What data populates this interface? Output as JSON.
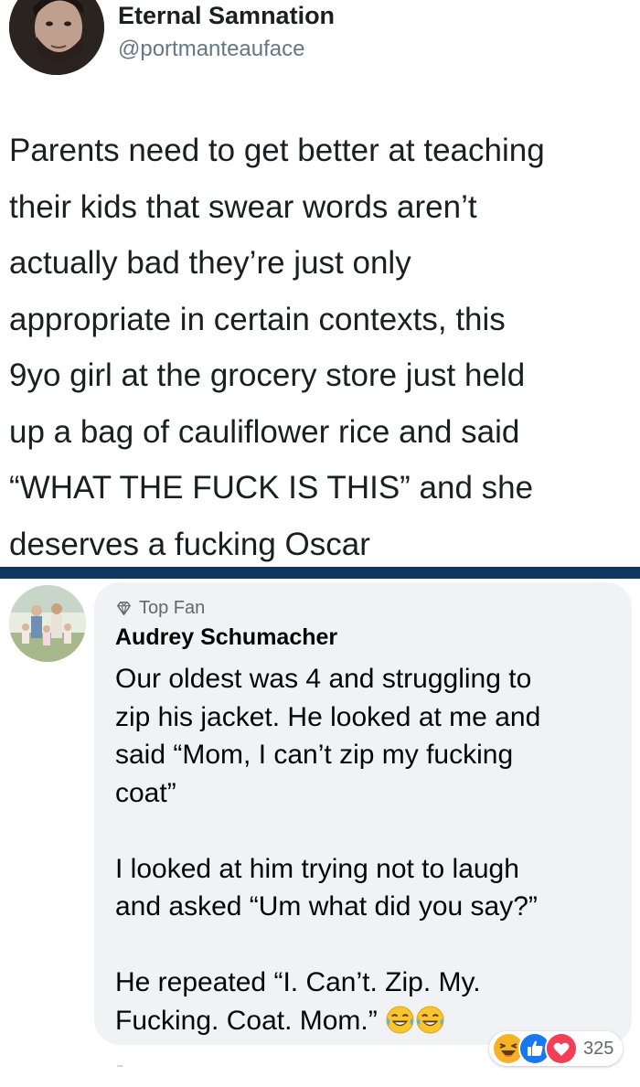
{
  "tweet": {
    "author_name": "Eternal Samnation",
    "handle": "@portmanteauface",
    "lines": [
      "Parents need to get better at teaching",
      "their kids that swear words aren’t",
      "actually bad they’re just only",
      "appropriate in certain contexts, this",
      "9yo girl at the grocery store just held",
      "up a bag of cauliflower rice and said",
      "“WHAT THE FUCK IS THIS” and she",
      "deserves a fucking Oscar"
    ]
  },
  "comment": {
    "badge": "Top Fan",
    "author": "Audrey Schumacher",
    "lines": [
      "Our oldest was 4 and struggling to",
      "zip his jacket. He looked at me and",
      "said “Mom, I can’t zip my fucking",
      "coat”",
      "",
      "I looked at him trying not to laugh",
      "and asked “Um what did you say?”",
      "",
      "He repeated “I. Can’t. Zip. My.",
      "Fucking. Coat. Mom.”"
    ],
    "reaction_count": "325",
    "reactions": [
      "haha-icon",
      "like-icon",
      "love-icon"
    ],
    "trailing_emoji": [
      "tears-of-joy-icon",
      "tears-of-joy-icon"
    ]
  },
  "colors": {
    "divider": "#12375f",
    "bubble": "#f0f2f5",
    "like": "#1877f2",
    "love": "#f33e58",
    "haha": "#f7b125"
  }
}
